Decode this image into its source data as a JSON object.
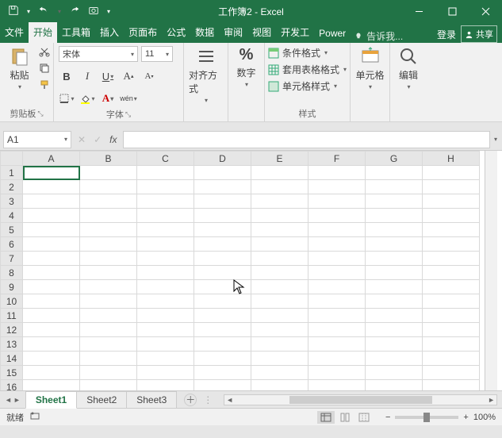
{
  "window": {
    "title": "工作簿2 - Excel"
  },
  "tabs": {
    "file": "文件",
    "home": "开始",
    "toolbox": "工具箱",
    "insert": "插入",
    "layout": "页面布",
    "formula": "公式",
    "data": "数据",
    "review": "审阅",
    "view": "视图",
    "dev": "开发工",
    "power": "Power",
    "tellme": "告诉我...",
    "login": "登录",
    "share": "共享"
  },
  "ribbon": {
    "clipboard": {
      "label": "剪贴板",
      "paste": "粘贴"
    },
    "font": {
      "label": "字体",
      "name": "宋体",
      "size": "11",
      "bold": "B",
      "italic": "I",
      "underline": "U",
      "phonetic": "wén"
    },
    "align": {
      "label": "对齐方式"
    },
    "number": {
      "label": "数字",
      "symbol": "%"
    },
    "styles": {
      "label": "样式",
      "cond": "条件格式",
      "table": "套用表格格式",
      "cell": "单元格样式"
    },
    "cells": {
      "label": "单元格"
    },
    "editing": {
      "label": "编辑"
    }
  },
  "fx": {
    "name": "A1",
    "fxlabel": "fx"
  },
  "grid": {
    "cols": [
      "A",
      "B",
      "C",
      "D",
      "E",
      "F",
      "G",
      "H"
    ],
    "rows": [
      "1",
      "2",
      "3",
      "4",
      "5",
      "6",
      "7",
      "8",
      "9",
      "10",
      "11",
      "12",
      "13",
      "14",
      "15",
      "16"
    ]
  },
  "sheets": {
    "s1": "Sheet1",
    "s2": "Sheet2",
    "s3": "Sheet3"
  },
  "status": {
    "ready": "就绪",
    "zoom": "100%",
    "minus": "−",
    "plus": "+"
  }
}
